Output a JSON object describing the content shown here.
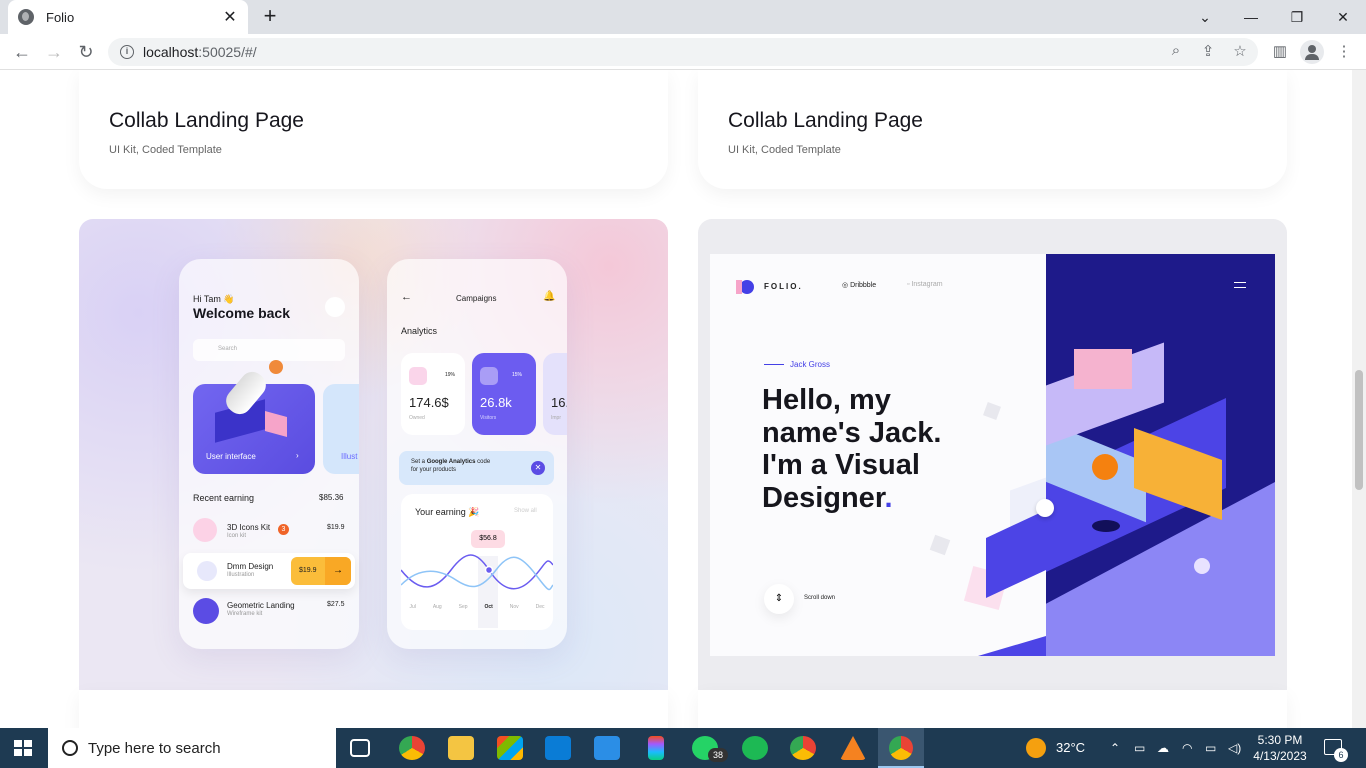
{
  "browser": {
    "tab_title": "Folio",
    "tab_close": "✕",
    "new_tab": "+",
    "url_host": "localhost",
    "url_rest": ":50025/#/"
  },
  "cards": [
    {
      "title": "Collab Landing Page",
      "subtitle": "UI Kit, Coded Template"
    },
    {
      "title": "Collab Landing Page",
      "subtitle": "UI Kit, Coded Template"
    }
  ],
  "app_mock": {
    "greeting": "Hi Tam 👋",
    "welcome": "Welcome back",
    "search": "Search",
    "feature_label": "User interface",
    "feature_label2": "Illust",
    "recent_label": "Recent earning",
    "recent_total": "$85.36",
    "items": [
      {
        "name": "3D Icons Kit",
        "sub": "Icon kit",
        "price": "$19.9",
        "badge": "3"
      },
      {
        "name": "Dmm Design",
        "sub": "Illustration",
        "price": "$19.9"
      },
      {
        "name": "Geometric Landing",
        "sub": "Wireframe kit",
        "price": "$27.5"
      }
    ],
    "campaigns_title": "Campaigns",
    "analytics_label": "Analytics",
    "stat1_value": "174.6$",
    "stat1_label": "Owned",
    "stat1_pct": "19%",
    "stat2_value": "26.8k",
    "stat2_label": "Visitors",
    "stat2_pct": "15%",
    "stat3_value": "16.",
    "stat3_label": "Impr",
    "promo_text1": "Set a ",
    "promo_bold": "Google Analytics",
    "promo_text2": " code",
    "promo_text3": "for your products",
    "earning_title": "Your earning 🎉",
    "show_all": "Show all",
    "tooltip": "$56.8",
    "months": [
      "Jul",
      "Aug",
      "Sep",
      "Oct",
      "Nov",
      "Dec"
    ]
  },
  "folio_mock": {
    "logo": "FOLIO.",
    "link1": "Dribbble",
    "link2": "Instagram",
    "author": "Jack Gross",
    "hero_line1": "Hello, my",
    "hero_line2": "name's Jack.",
    "hero_line3": "I'm a Visual",
    "hero_line4": "Designer",
    "hero_dot": ".",
    "scroll": "Scroll down",
    "accent": "#4440e6",
    "dark_panel": "#1e1a8a"
  },
  "taskbar": {
    "search_placeholder": "Type here to search",
    "weather": "32°C",
    "time": "5:30 PM",
    "date": "4/13/2023",
    "whatsapp_badge": "38",
    "notif_count": "6"
  }
}
